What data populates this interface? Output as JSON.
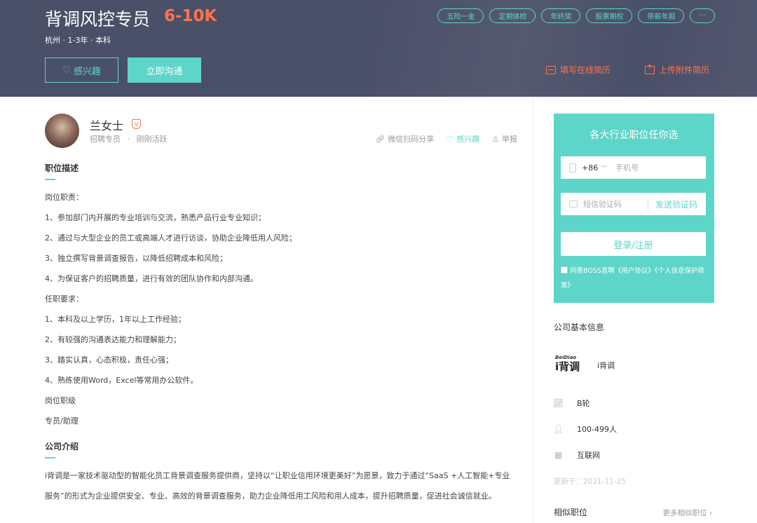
{
  "header": {
    "job_title": "背调风控专员",
    "salary": "6-10K",
    "meta": "杭州 · 1-3年 · 本科",
    "interest_btn": "感兴趣",
    "chat_btn": "立即沟通",
    "tags": [
      "五险一金",
      "定期体检",
      "年终奖",
      "股票期权",
      "带薪年假",
      "···"
    ],
    "fill_resume": "填写在线简历",
    "upload_resume": "上传附件简历"
  },
  "recruiter": {
    "name": "兰女士",
    "badge": "V",
    "role": "招聘专员",
    "separator": "·",
    "status": "刚刚活跃"
  },
  "actions": {
    "share": "微信扫码分享",
    "interest": "感兴趣",
    "report": "举报"
  },
  "description": {
    "title": "职位描述",
    "lines": [
      "岗位职责：",
      "1、参加部门内开展的专业培训与交流，熟悉产品行业专业知识；",
      "2、通过与大型企业的员工或高端人才进行访谈，协助企业降低用人风险；",
      "3、独立撰写背景调查报告，以降低招聘成本和风险；",
      "4、为保证客户的招聘质量，进行有效的团队协作和内部沟通。",
      "任职要求：",
      "1、本科及以上学历，1年以上工作经验；",
      "2、有较强的沟通表达能力和理解能力；",
      "3、踏实认真，心态积极，责任心强；",
      "4、熟练使用Word，Excel等常用办公软件。",
      "岗位职级",
      "专员/助理"
    ]
  },
  "company_intro": {
    "title": "公司介绍",
    "line1": "i背调是一家技术驱动型的智能化员工背景调查服务提供商，坚持以“让职业信用环境更美好”为愿景，致力于通过“SaaS +人工智能+专业",
    "line2": "服务”的形式为企业提供安全、专业、高效的背景调查服务，助力企业降低用工风险和用人成本，提升招聘质量，促进社会诚信就业。"
  },
  "login": {
    "title": "各大行业职位任你选",
    "country_code": "+86",
    "phone_placeholder": "手机号",
    "code_placeholder": "短信验证码",
    "send_code": "发送验证码",
    "submit": "登录/注册",
    "agreement": "同意BOSS直聘《用户协议》《个人信息保护政策》"
  },
  "company": {
    "section_title": "公司基本信息",
    "logo_small": "BeiDiao",
    "logo_big": "i背调",
    "name": "i背调",
    "stage": "B轮",
    "size": "100-499人",
    "industry": "互联网",
    "updated": "更新于：2021-11-25"
  },
  "similar": {
    "title": "相似职位",
    "more": "更多相似职位 ›"
  }
}
